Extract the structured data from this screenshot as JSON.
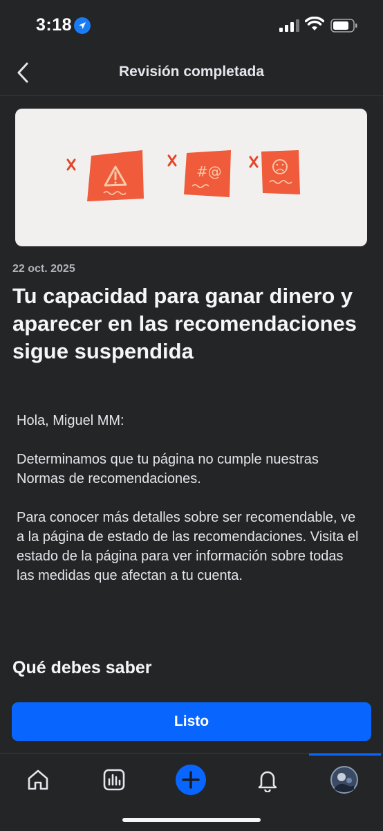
{
  "status_bar": {
    "time": "3:18"
  },
  "header": {
    "title": "Revisión completada"
  },
  "card": {
    "date": "22 oct. 2025",
    "headline": "Tu capacidad para ganar dinero y aparecer en las recomendaciones sigue suspendida",
    "greeting": "Hola, Miguel MM:",
    "paragraph_1": "Determinamos que tu página no cumple nuestras Normas de recomendaciones.",
    "paragraph_2": "Para conocer más detalles sobre ser recomendable, ve a la página de estado de las recomendaciones. Visita el estado de la página para ver información sobre todas las medidas que afectan a tu cuenta."
  },
  "section": {
    "title": "Qué debes saber"
  },
  "actions": {
    "done_label": "Listo"
  },
  "tab_bar": {
    "items": [
      {
        "icon": "home-icon"
      },
      {
        "icon": "insights-icon"
      },
      {
        "icon": "create-plus-icon"
      },
      {
        "icon": "bell-icon"
      },
      {
        "icon": "profile-avatar"
      }
    ],
    "active_index": 4
  },
  "colors": {
    "background": "#242527",
    "accent": "#0866ff",
    "warning_card": "#ef5b3b",
    "text_primary": "#f5f6f7",
    "text_secondary": "#b0b3b8"
  }
}
